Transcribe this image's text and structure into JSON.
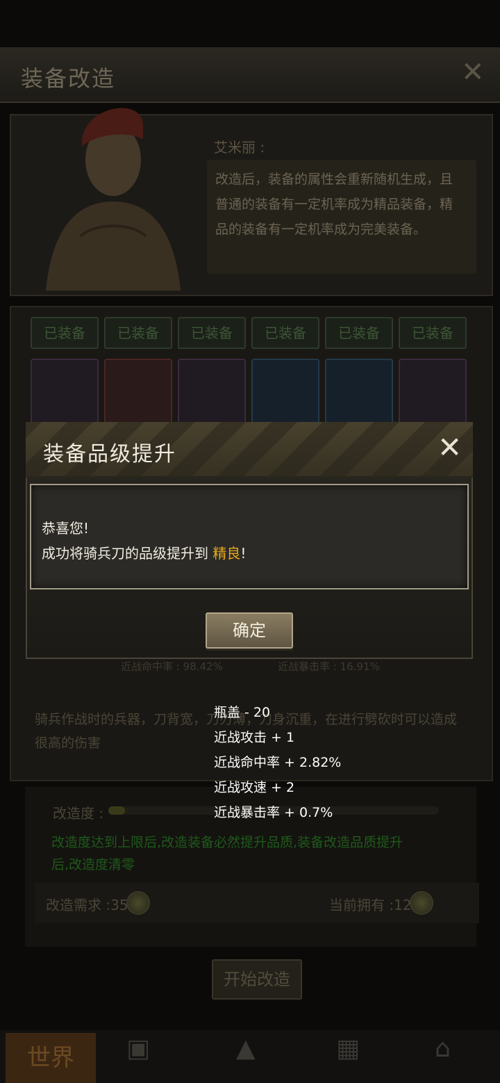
{
  "screen": {
    "title": "装备改造",
    "npc": {
      "name": "艾米丽 :",
      "dialog": "改造后，装备的属性会重新随机生成，且普通的装备有一定机率成为精品装备，精品的装备有一定机率成为完美装备。"
    },
    "equipment_tags": [
      "已装备",
      "已装备",
      "已装备",
      "已装备",
      "已装备",
      "已装备"
    ],
    "faded_stats": [
      "近战命中率 : 98.42%",
      "近战暴击率 : 16.91%"
    ],
    "description": "骑兵作战时的兵器，刀背宽，刀刃薄，刀身沉重，在进行劈砍时可以造成很高的伤害",
    "progress": {
      "label": "改造度 :",
      "value": 0.05,
      "note": "改造度达到上限后,改造装备必然提升品质,装备改造品质提升后,改造度清零"
    },
    "requirement": {
      "label": "改造需求 :35",
      "owned": "当前拥有 :12"
    },
    "start_button": "开始改造",
    "tabs": {
      "world": "世界"
    }
  },
  "dialog": {
    "title": "装备品级提升",
    "line1": "恭喜您!",
    "line2_prefix": "成功将骑兵刀的品级提升到",
    "quality": "精良",
    "line2_suffix": "!",
    "confirm_label": "确定"
  },
  "stat_changes": [
    "瓶盖 - 20",
    "近战攻击 + 1",
    "近战命中率 + 2.82%",
    "近战攻速 + 2",
    "近战暴击率 + 0.7%"
  ],
  "colors": {
    "quality": "#e9a81e",
    "accent_green": "#1f5a1a"
  },
  "icons": {
    "close": "close-icon",
    "coin": "bottle-cap-coin-icon"
  }
}
